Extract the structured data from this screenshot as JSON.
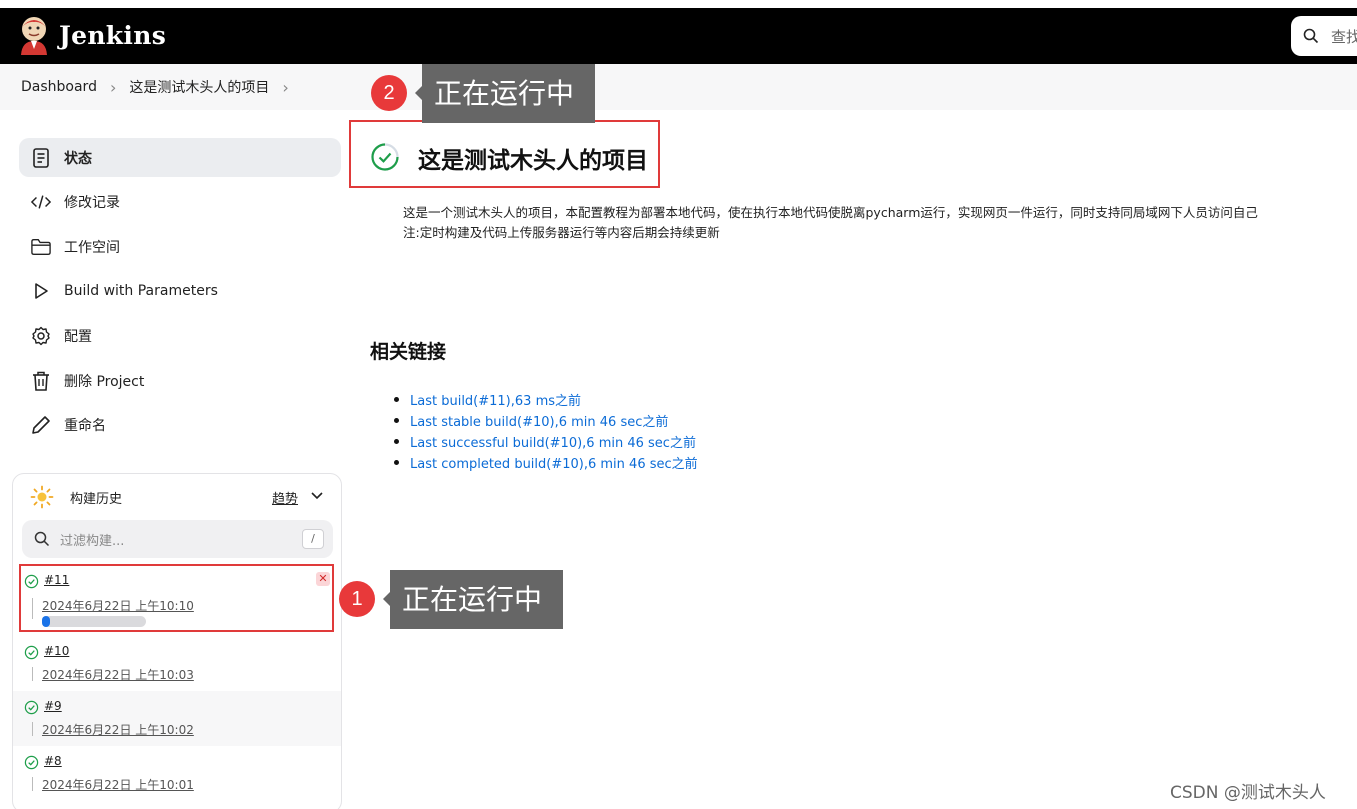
{
  "header": {
    "app_name": "Jenkins",
    "search_placeholder": "查找"
  },
  "breadcrumb": {
    "items": [
      "Dashboard",
      "这是测试木头人的项目"
    ]
  },
  "sidebar": {
    "items": [
      {
        "label": "状态",
        "icon": "document-icon",
        "active": true
      },
      {
        "label": "修改记录",
        "icon": "code-icon",
        "active": false
      },
      {
        "label": "工作空间",
        "icon": "folder-icon",
        "active": false
      },
      {
        "label": "Build with Parameters",
        "icon": "play-icon",
        "active": false
      },
      {
        "label": "配置",
        "icon": "gear-icon",
        "active": false
      },
      {
        "label": "删除 Project",
        "icon": "trash-icon",
        "active": false
      },
      {
        "label": "重命名",
        "icon": "pencil-icon",
        "active": false
      }
    ]
  },
  "build_history": {
    "title": "构建历史",
    "trend_label": "趋势",
    "filter_placeholder": "过滤构建...",
    "filter_shortcut": "/",
    "builds": [
      {
        "number": "#11",
        "date": "2024年6月22日 上午10:10",
        "running": true,
        "progress": 0.08
      },
      {
        "number": "#10",
        "date": "2024年6月22日 上午10:03",
        "running": false
      },
      {
        "number": "#9",
        "date": "2024年6月22日 上午10:02",
        "running": false
      },
      {
        "number": "#8",
        "date": "2024年6月22日 上午10:01",
        "running": false
      }
    ]
  },
  "main": {
    "project_title": "这是测试木头人的项目",
    "description_lines": [
      "这是一个测试木头人的项目，本配置教程为部署本地代码，使在执行本地代码使脱离pycharm运行，实现网页一件运行，同时支持同局域网下人员访问自己",
      "注:定时构建及代码上传服务器运行等内容后期会持续更新"
    ],
    "related_links_title": "相关链接",
    "links": [
      "Last build(#11),63 ms之前",
      "Last stable build(#10),6 min 46 sec之前",
      "Last successful build(#10),6 min 46 sec之前",
      "Last completed build(#10),6 min 46 sec之前"
    ]
  },
  "annotations": [
    {
      "number": "1",
      "text": "正在运行中"
    },
    {
      "number": "2",
      "text": "正在运行中"
    }
  ],
  "watermark": "CSDN @测试木头人",
  "colors": {
    "header_bg": "#000000",
    "link": "#0b6bd6",
    "success": "#1e9e4a",
    "annotation_red": "#e8393a",
    "progress": "#1a73e8"
  }
}
